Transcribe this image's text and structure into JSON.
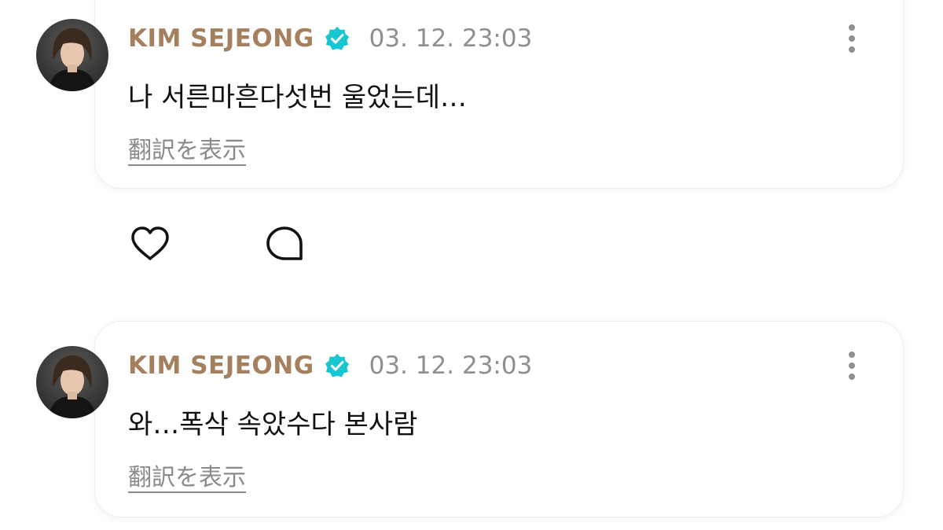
{
  "colors": {
    "author": "#a5805e",
    "verified_badge": "#18c6d1",
    "timestamp": "#8e8e93",
    "body_text": "#111111",
    "translate_link": "#8a8a8e",
    "card_border": "#ececf2",
    "background": "#ffffff"
  },
  "posts": [
    {
      "author": "KIM SEJEONG",
      "verified": true,
      "timestamp": "03. 12. 23:03",
      "text": "나 서른마흔다섯번 울었는데…",
      "translate_label": "翻訳を表示",
      "icons": {
        "avatar": "profile-photo",
        "verified": "verified-badge-icon",
        "more": "more-vertical-icon"
      }
    },
    {
      "author": "KIM SEJEONG",
      "verified": true,
      "timestamp": "03. 12. 23:03",
      "text": "와…폭삭 속았수다 본사람",
      "translate_label": "翻訳を表示",
      "icons": {
        "avatar": "profile-photo",
        "verified": "verified-badge-icon",
        "more": "more-vertical-icon"
      }
    }
  ],
  "actions": {
    "icons": [
      "heart-icon",
      "comment-bubble-icon"
    ]
  }
}
